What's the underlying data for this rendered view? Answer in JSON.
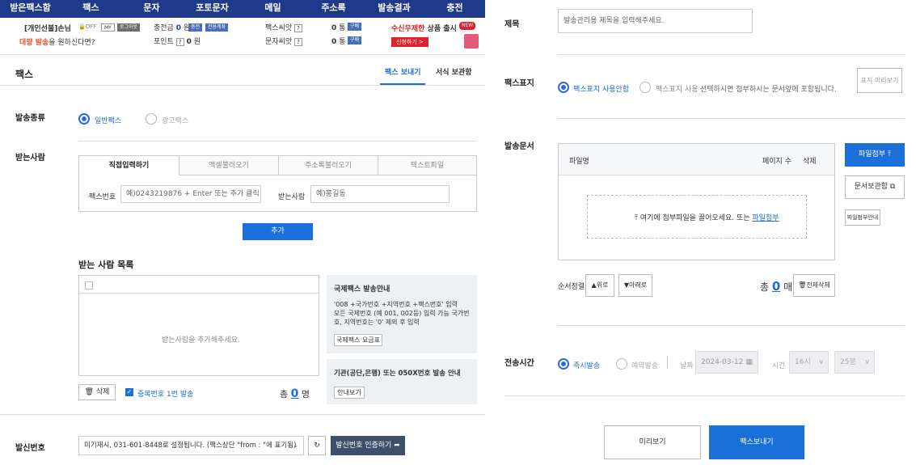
{
  "nav": [
    "받은팩스함",
    "팩스",
    "문자",
    "포토문자",
    "메일",
    "주소록",
    "발송결과",
    "충전"
  ],
  "userbar": {
    "user_name": "[개인선불]손님",
    "promo": "대량 발송",
    "promo_suffix": "을 원하신다면?",
    "off_label": "OFF",
    "my_label": "MY",
    "logout_label": "로그아웃",
    "charge_label": "충전금",
    "charge_value": "0",
    "won": "원",
    "charge_btn": "충전",
    "charge_pay_btn": "전용계좌",
    "point_label": "포인트",
    "point_value": "0",
    "fax_label": "팩스씨앗",
    "sms_label": "문자씨앗",
    "qmark": "?",
    "fax_seed_value": "0",
    "sms_seed_value": "0",
    "unit": "통",
    "buy_btn": "구매",
    "ad_title": "수신무제한",
    "ad_title_suffix": " 상품 출시",
    "ad_new": "NEW",
    "ad_btn": "신청하기 >"
  },
  "page": {
    "title": "팩스",
    "tab_send": "팩스 보내기",
    "tab_storage": "서식 보관함"
  },
  "send_type": {
    "label": "발송종류",
    "normal": "일반팩스",
    "ad": "광고팩스"
  },
  "recipient": {
    "label": "받는사람",
    "tabs": [
      "직접입력하기",
      "엑셀불러오기",
      "주소록불러오기",
      "텍스트파일"
    ],
    "fax_label": "팩스번호",
    "fax_placeholder": "예)0243219876 + Enter 또는 추가 클릭",
    "name_label": "받는사람",
    "name_placeholder": "예)홍길동",
    "add_btn": "추가"
  },
  "list": {
    "title": "받는 사람 목록",
    "empty": "받는사람을 추가해주세요.",
    "delete_btn": "삭제",
    "dup_label": "중복번호 1번 발송",
    "total_prefix": "총",
    "total_count": "0",
    "total_unit": "명"
  },
  "intl": {
    "title": "국제팩스 발송안내",
    "line1": "'008 +국가번호 +지역번호 +팩스번호' 입력",
    "line2": "모든 국제번호 (예 001, 002등) 입력 가능 국가번",
    "line3": "호, 지역번호는 '0' 제외 후 입력",
    "btn": "국제팩스 요금표"
  },
  "org": {
    "title": "기관(공단,은행) 또는 050X번호 발송 안내",
    "btn": "안내보기"
  },
  "sender": {
    "label": "발신번호",
    "value": "미기재시, 031-601-8448로 설정됩니다. (팩스상단 \"from : \"에 표기됨)",
    "auth_btn": "발신번호 인증하기"
  },
  "subject": {
    "label": "제목",
    "placeholder": "발송관리용 제목을 입력해주세요."
  },
  "cover": {
    "label": "팩스표지",
    "off": "팩스표지 사용안함",
    "on": "팩스표지 사용",
    "desc": "선택하시면 첨부하시는 문서앞에 포함됩니다.",
    "preview_btn": "표지 미리보기"
  },
  "doc": {
    "label": "발송문서",
    "col_name": "파일명",
    "col_pages": "페이지 수",
    "col_delete": "삭제",
    "drop_text": "여기에 첨부파일을 끌어오세요. 또는",
    "drop_link": "파일첨부",
    "attach_btn": "파일첨부",
    "storage_btn": "문서보관함",
    "guide_btn": "파일첨부안내",
    "order_label": "순서정렬",
    "up_btn": "위로",
    "down_btn": "아래로",
    "total_prefix": "총",
    "total_count": "0",
    "total_unit": "매",
    "delete_all_btn": "전체삭제"
  },
  "schedule": {
    "label": "전송시간",
    "now": "즉시발송",
    "reserve": "예약발송",
    "date_label": "날짜",
    "date": "2024-03-12",
    "time_label": "시간",
    "hour": "16시",
    "minute": "25분"
  },
  "actions": {
    "preview": "미리보기",
    "send": "팩스보내기"
  }
}
